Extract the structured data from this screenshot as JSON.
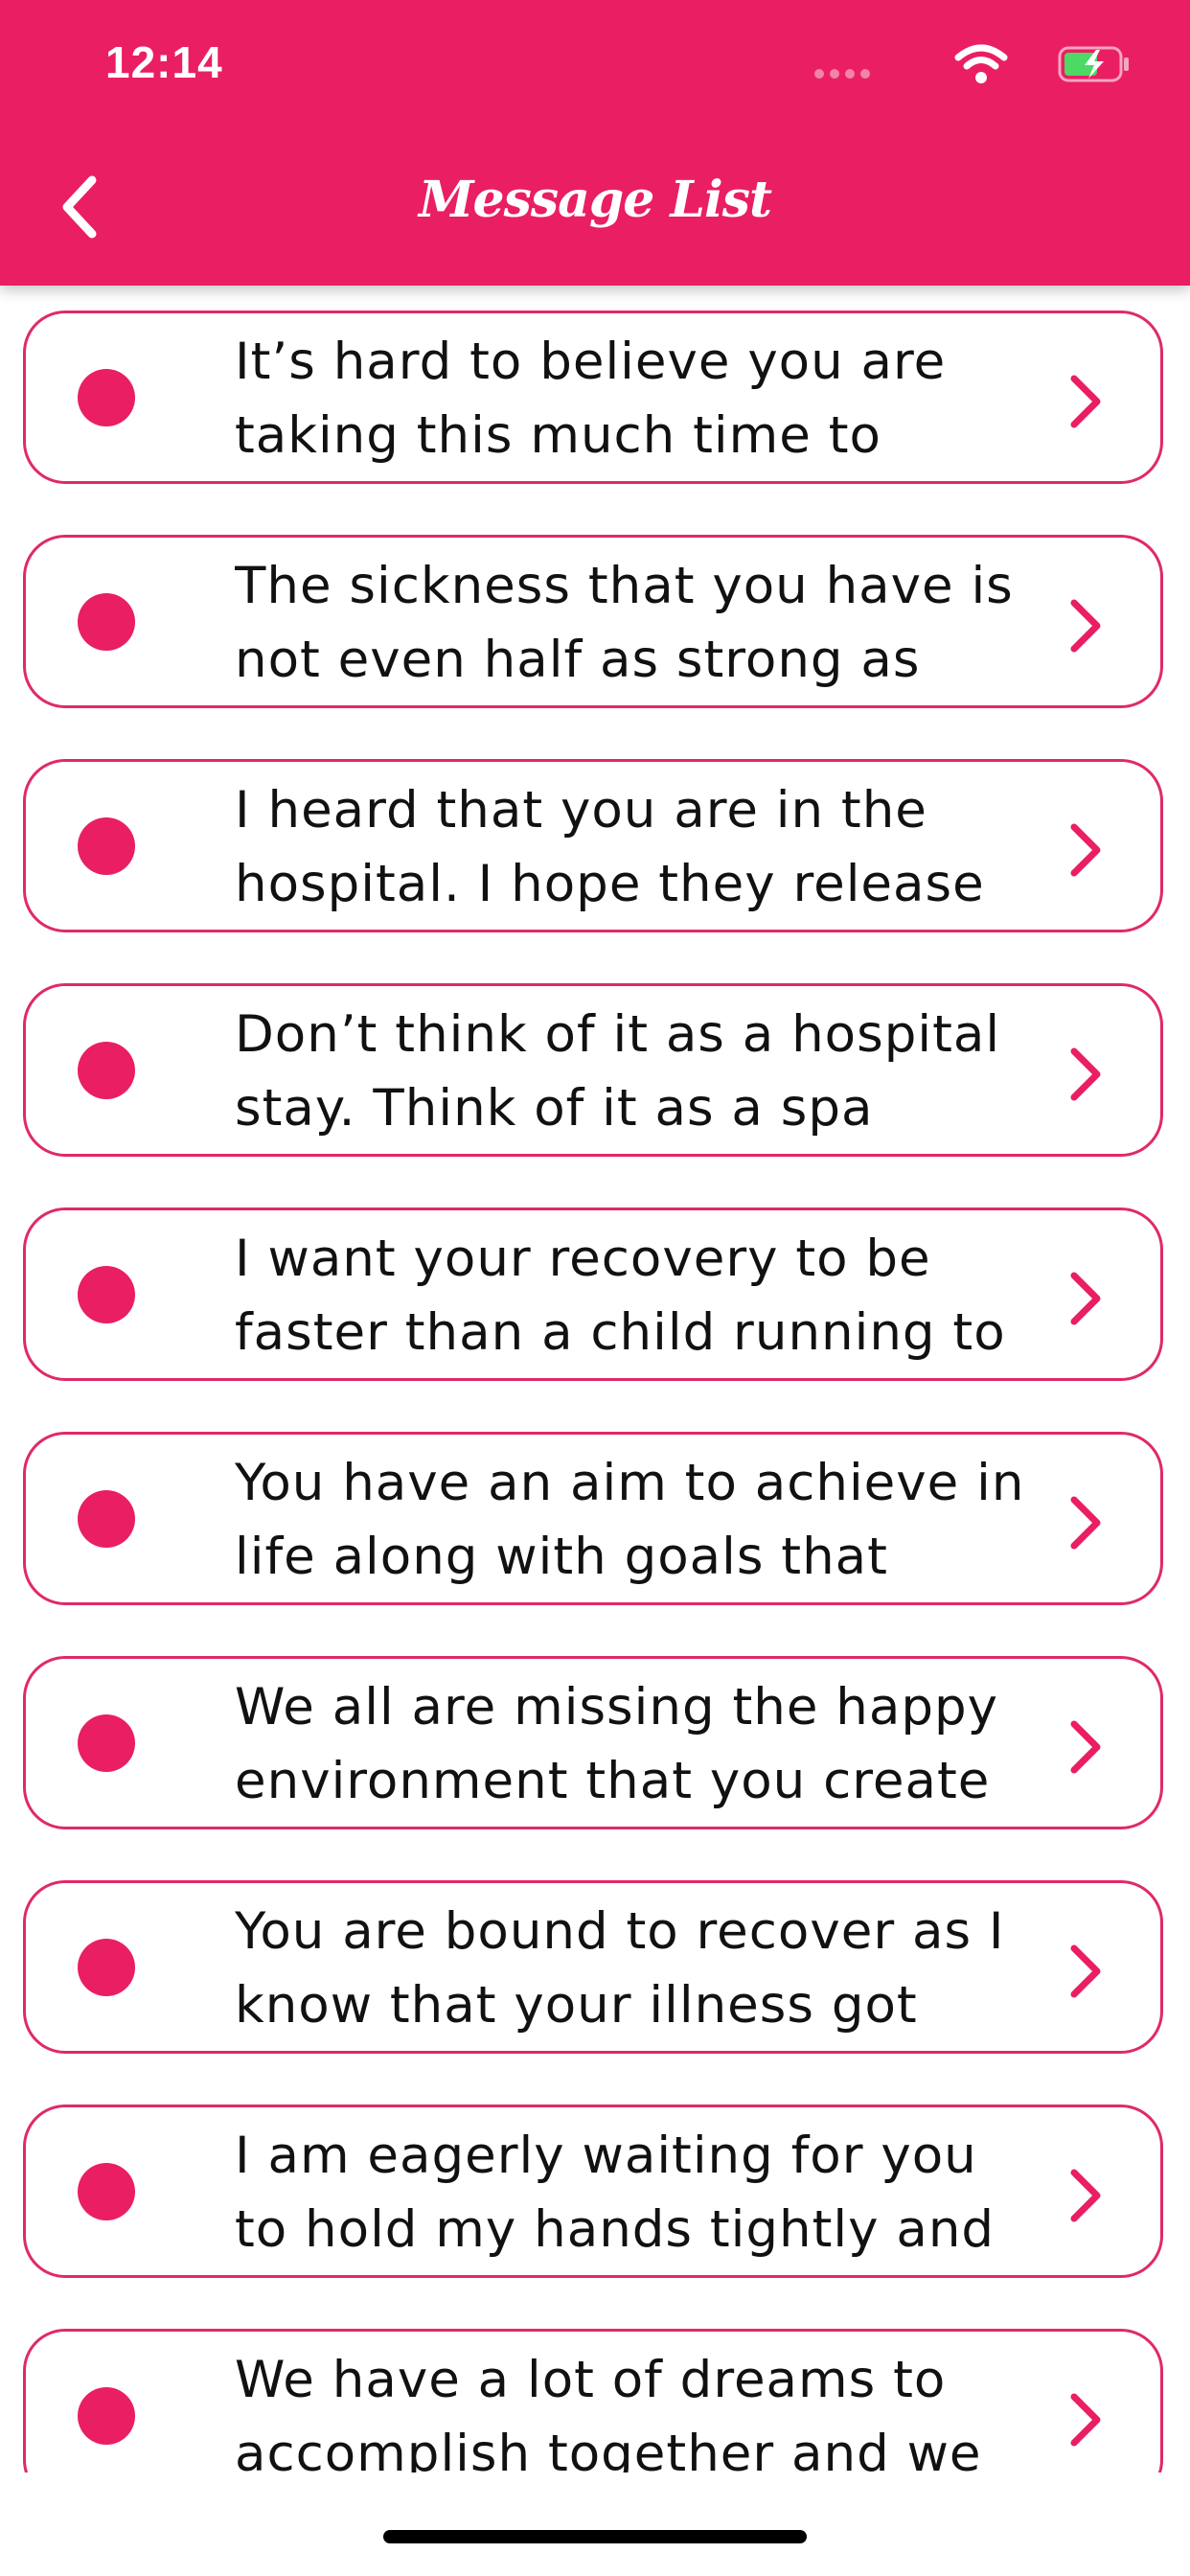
{
  "status_bar": {
    "time": "12:14"
  },
  "header": {
    "title": "Message List",
    "back_icon": "chevron-left-icon"
  },
  "colors": {
    "accent": "#ea1e63",
    "card_border": "#e0296a",
    "text": "#111111"
  },
  "messages": [
    "It’s hard to believe you are taking this much time to",
    "The sickness that you have is not even half as strong as",
    "I heard that you are in the hospital. I hope they release",
    "Don’t think of it as a hospital stay. Think of it as a spa",
    "I want your recovery to be faster than a child running to",
    "You have an aim to achieve in life along with goals that",
    "We all are missing the happy environment that you create",
    "You are bound to recover as I know that your illness got",
    "I am eagerly waiting for you to hold my hands tightly and",
    "We have a lot of dreams to accomplish together and we"
  ]
}
